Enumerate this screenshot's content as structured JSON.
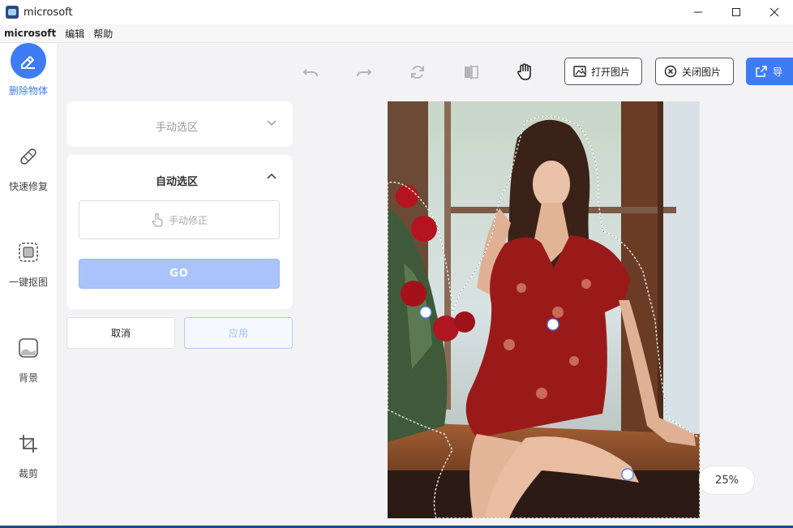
{
  "window": {
    "title": "microsoft"
  },
  "menu": {
    "brand": "microsoft",
    "items": [
      "编辑",
      "帮助"
    ]
  },
  "nav": {
    "items": [
      {
        "label": "删除物体",
        "icon": "eraser-icon"
      },
      {
        "label": "快速修复",
        "icon": "bandage-icon"
      },
      {
        "label": "一键抠图",
        "icon": "cutout-icon"
      },
      {
        "label": "背景",
        "icon": "background-icon"
      },
      {
        "label": "裁剪",
        "icon": "crop-icon"
      }
    ]
  },
  "toolbar": {
    "open_image": "打开图片",
    "close_image": "关闭图片",
    "export_partial": "导"
  },
  "panel": {
    "manual_select": "手动选区",
    "auto_select": "自动选区",
    "manual_fix": "手动修正",
    "go": "GO",
    "cancel": "取消",
    "apply": "应用"
  },
  "zoom": "25%",
  "colors": {
    "accent": "#3f7cf4",
    "go_disabled": "#aac4fb"
  }
}
